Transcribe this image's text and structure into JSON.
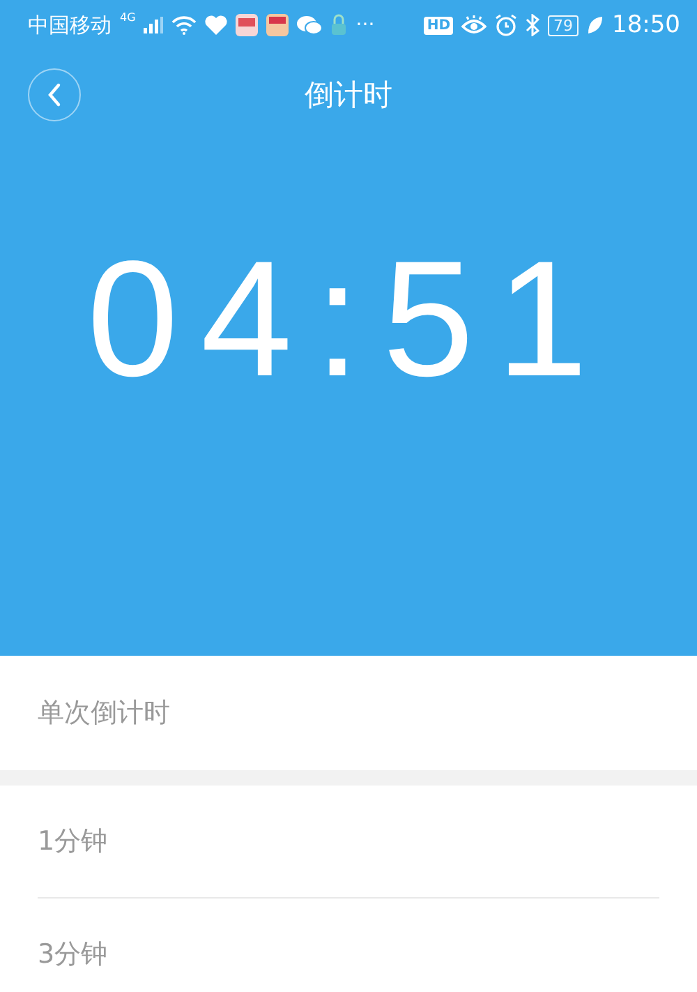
{
  "status_bar": {
    "carrier": "中国移动",
    "network": "4G",
    "overflow": "···",
    "hd": "HD",
    "battery": "79",
    "time": "18:50"
  },
  "header": {
    "title": "倒计时"
  },
  "timer": {
    "display": "04:51"
  },
  "section": {
    "title": "单次倒计时"
  },
  "presets": [
    {
      "label": "1分钟"
    },
    {
      "label": "3分钟"
    }
  ]
}
